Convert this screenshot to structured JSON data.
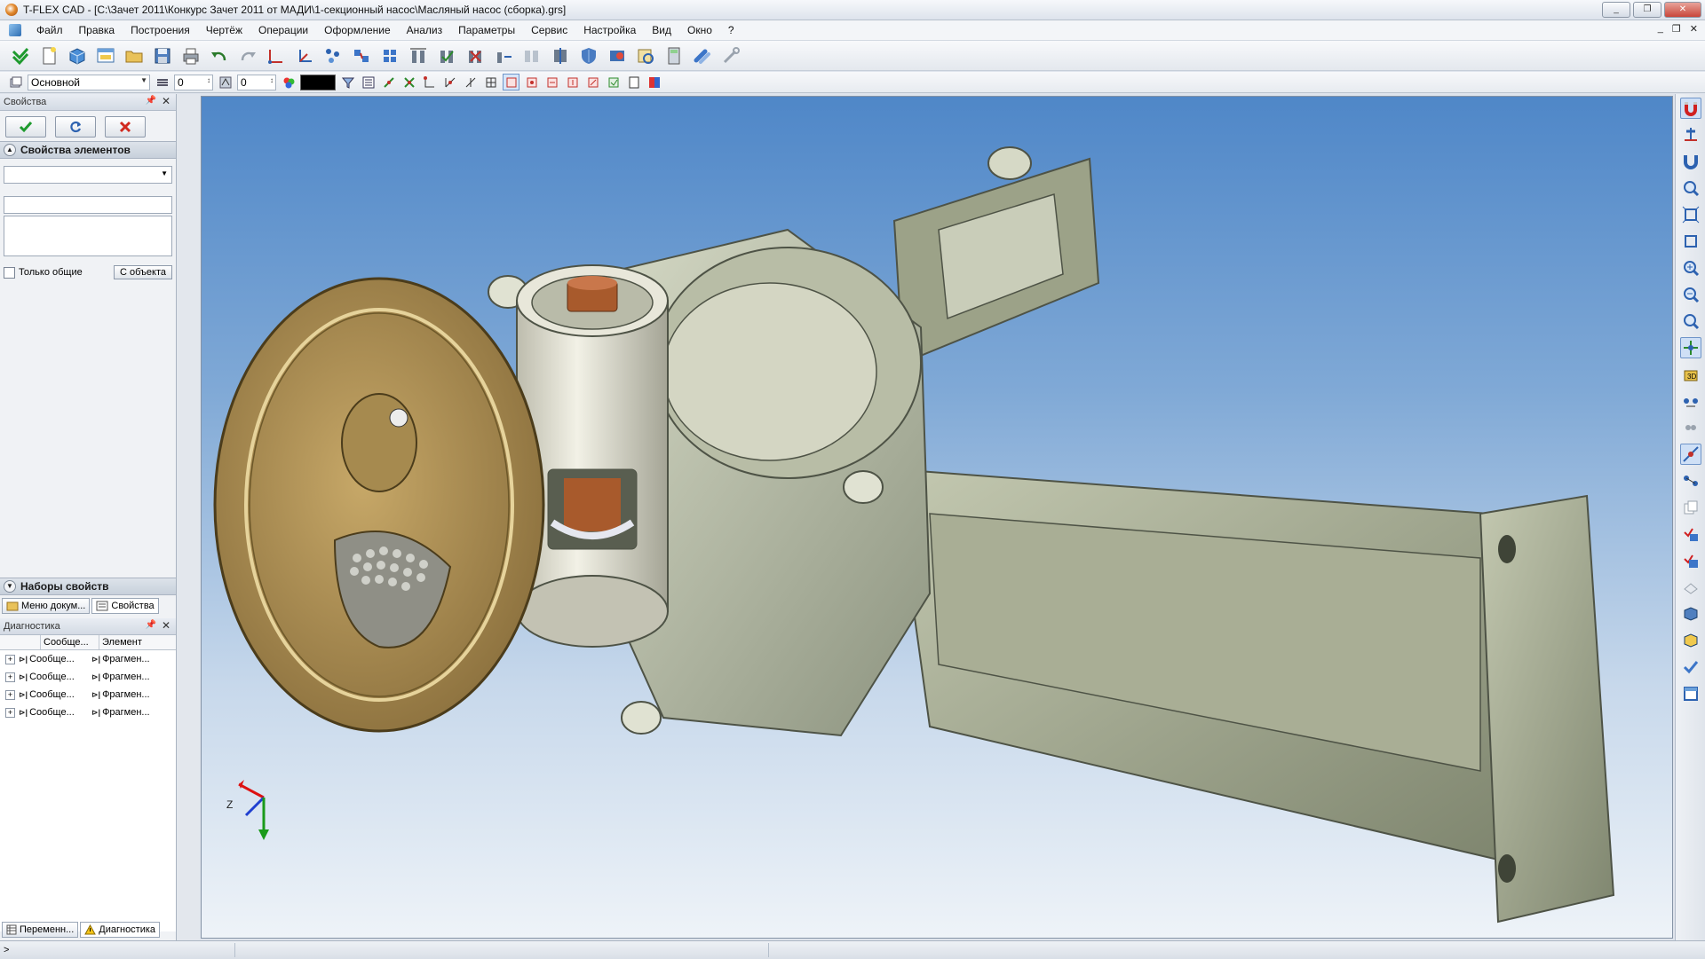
{
  "window": {
    "title": "T-FLEX CAD - [C:\\Зачет 2011\\Конкурс Зачет 2011 от МАДИ\\1-секционный насос\\Масляный насос (сборка).grs]",
    "controls": [
      "_",
      "❐",
      "✕"
    ]
  },
  "menu": {
    "items": [
      "Файл",
      "Правка",
      "Построения",
      "Чертёж",
      "Операции",
      "Оформление",
      "Анализ",
      "Параметры",
      "Сервис",
      "Настройка",
      "Вид",
      "Окно",
      "?"
    ],
    "mdi_controls": [
      "_",
      "❐",
      "✕"
    ]
  },
  "toolbar2": {
    "layer": "Основной",
    "level_value": "0",
    "priority_value": "0",
    "color": "#000000"
  },
  "properties_panel": {
    "title": "Свойства",
    "section_title": "Свойства элементов",
    "only_common_label": "Только общие",
    "from_object_button": "С объекта",
    "sets_title": "Наборы свойств",
    "tabs": [
      "Меню докум...",
      "Свойства"
    ]
  },
  "diagnostics_panel": {
    "title": "Диагностика",
    "columns": [
      "Сообще...",
      "Элемент"
    ],
    "rows": [
      {
        "message": "Сообще...",
        "element": "Фрагмен..."
      },
      {
        "message": "Сообще...",
        "element": "Фрагмен..."
      },
      {
        "message": "Сообще...",
        "element": "Фрагмен..."
      },
      {
        "message": "Сообще...",
        "element": "Фрагмен..."
      }
    ],
    "bottom_tabs": [
      "Переменн...",
      "Диагностика"
    ]
  },
  "viewport": {
    "axis_label": "Z",
    "background_top": "#4f87c8",
    "background_bottom": "#eef3f8",
    "model_colors": {
      "flange": "#b39456",
      "body": "#a4ab8f",
      "bracket": "#9aa189",
      "cylinder": "#dad9c9"
    }
  },
  "statusbar": {
    "text": ">"
  }
}
